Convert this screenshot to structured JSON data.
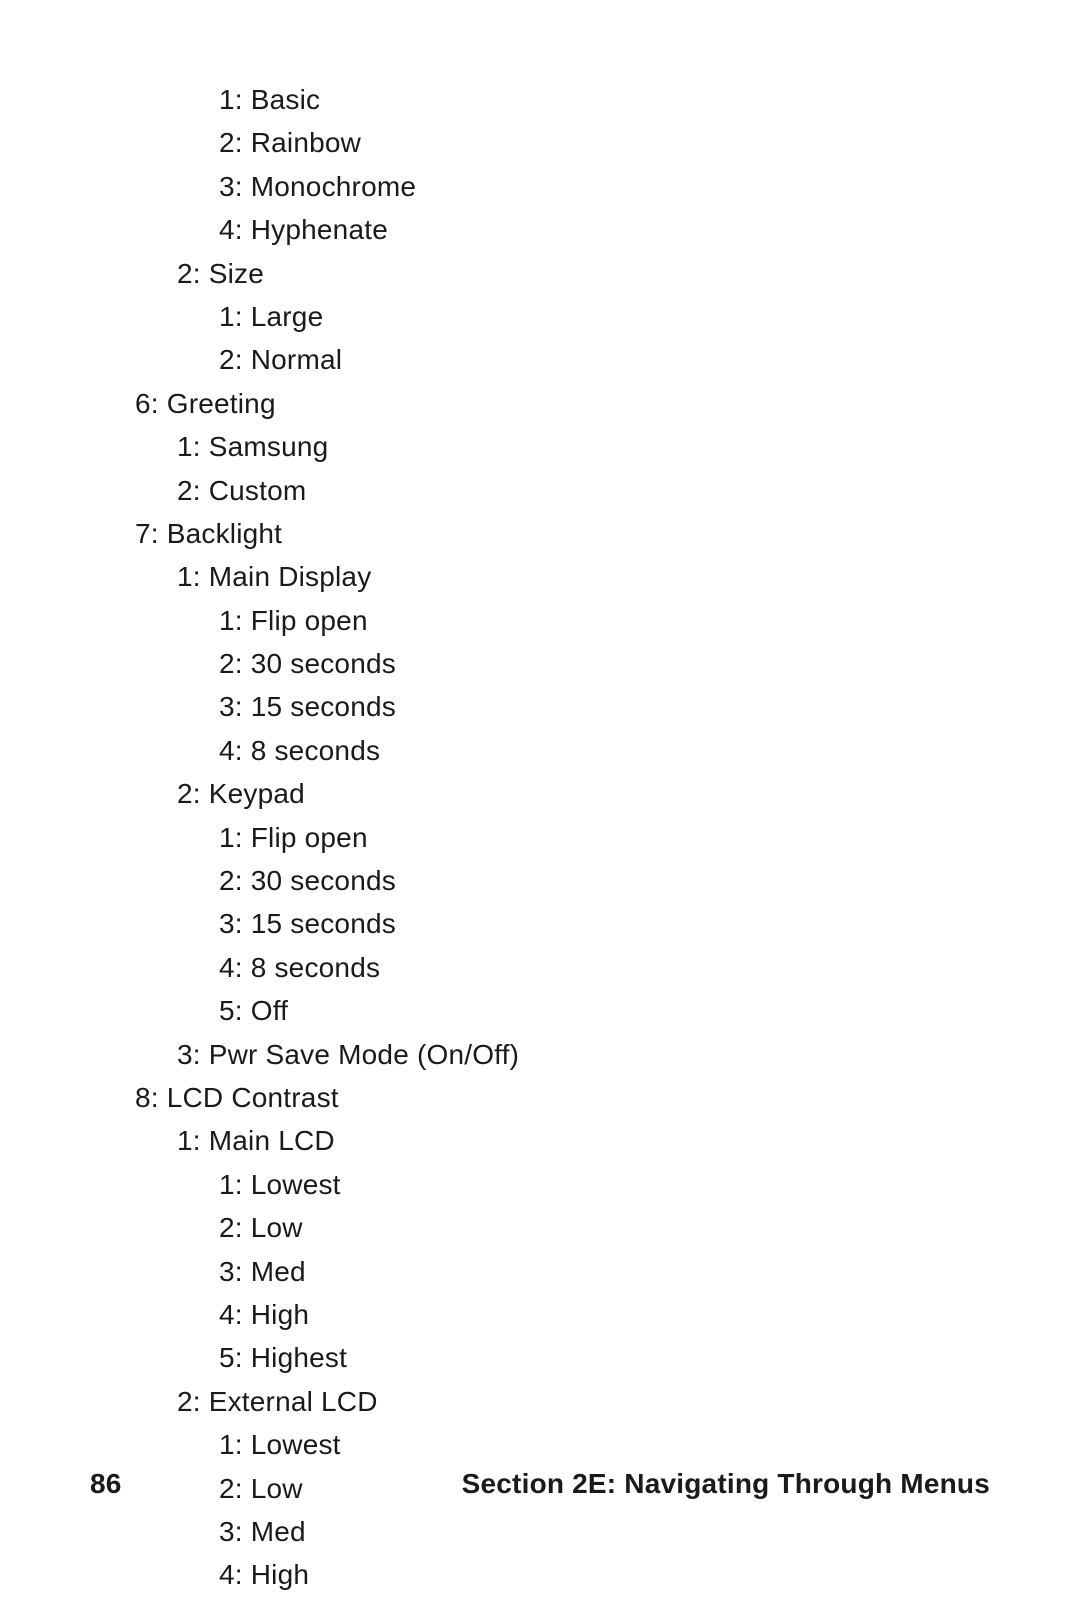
{
  "menu": [
    {
      "indent": 3,
      "text": "1: Basic"
    },
    {
      "indent": 3,
      "text": "2: Rainbow"
    },
    {
      "indent": 3,
      "text": "3: Monochrome"
    },
    {
      "indent": 3,
      "text": "4: Hyphenate"
    },
    {
      "indent": 2,
      "text": "2: Size"
    },
    {
      "indent": 3,
      "text": "1: Large"
    },
    {
      "indent": 3,
      "text": "2: Normal"
    },
    {
      "indent": 1,
      "text": "6: Greeting"
    },
    {
      "indent": 2,
      "text": "1: Samsung"
    },
    {
      "indent": 2,
      "text": "2: Custom"
    },
    {
      "indent": 1,
      "text": "7: Backlight"
    },
    {
      "indent": 2,
      "text": "1: Main Display"
    },
    {
      "indent": 3,
      "text": "1: Flip open"
    },
    {
      "indent": 3,
      "text": "2: 30 seconds"
    },
    {
      "indent": 3,
      "text": "3: 15 seconds"
    },
    {
      "indent": 3,
      "text": "4: 8 seconds"
    },
    {
      "indent": 2,
      "text": "2: Keypad"
    },
    {
      "indent": 3,
      "text": "1: Flip open"
    },
    {
      "indent": 3,
      "text": "2: 30 seconds"
    },
    {
      "indent": 3,
      "text": "3: 15 seconds"
    },
    {
      "indent": 3,
      "text": "4: 8 seconds"
    },
    {
      "indent": 3,
      "text": "5: Off"
    },
    {
      "indent": 2,
      "text": "3: Pwr Save Mode (On/Off)"
    },
    {
      "indent": 1,
      "text": "8: LCD Contrast"
    },
    {
      "indent": 2,
      "text": "1: Main LCD"
    },
    {
      "indent": 3,
      "text": "1: Lowest"
    },
    {
      "indent": 3,
      "text": "2: Low"
    },
    {
      "indent": 3,
      "text": "3: Med"
    },
    {
      "indent": 3,
      "text": "4: High"
    },
    {
      "indent": 3,
      "text": "5: Highest"
    },
    {
      "indent": 2,
      "text": "2: External LCD"
    },
    {
      "indent": 3,
      "text": "1: Lowest"
    },
    {
      "indent": 3,
      "text": "2: Low"
    },
    {
      "indent": 3,
      "text": "3: Med"
    },
    {
      "indent": 3,
      "text": "4: High"
    }
  ],
  "footer": {
    "page_number": "86",
    "section_title": "Section 2E: Navigating Through Menus"
  }
}
